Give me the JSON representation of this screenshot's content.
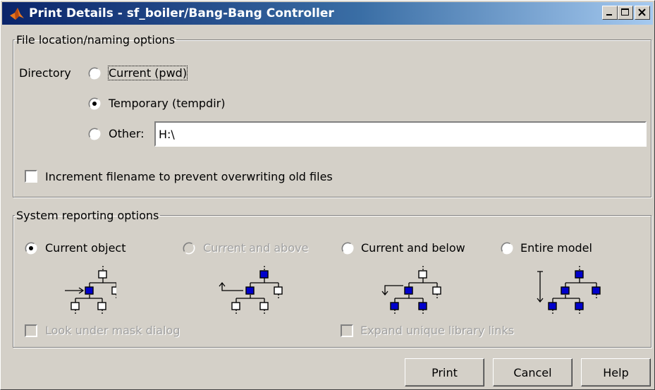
{
  "window": {
    "title": "Print Details - sf_boiler/Bang-Bang Controller",
    "controls": [
      "minimize-icon",
      "maximize-icon",
      "close-icon"
    ]
  },
  "file_options": {
    "legend": "File location/naming options",
    "directory_label": "Directory",
    "radios": {
      "current": "Current (pwd)",
      "temporary": "Temporary (tempdir)",
      "other": "Other:"
    },
    "selected": "temporary",
    "other_path": "H:\\",
    "increment_label": "Increment filename to prevent overwriting old files",
    "increment_checked": false
  },
  "system_options": {
    "legend": "System reporting options",
    "radios": {
      "current_object": "Current object",
      "current_and_above": "Current and above",
      "current_and_below": "Current and below",
      "entire_model": "Entire model"
    },
    "selected": "current_object",
    "disabled": [
      "current_and_above"
    ],
    "look_under_mask_label": "Look under mask dialog",
    "expand_library_links_label": "Expand unique library links"
  },
  "buttons": {
    "print": "Print",
    "cancel": "Cancel",
    "help": "Help"
  },
  "colors": {
    "dialog_bg": "#d4d0c8",
    "title_start": "#0a246a",
    "title_end": "#a6caf0",
    "tree_node_selected": "#0000cc"
  },
  "icons": {
    "app": "matlab-logo-icon",
    "tree_current_object": "hierarchy-current-object-icon",
    "tree_current_and_above": "hierarchy-current-and-above-icon",
    "tree_current_and_below": "hierarchy-current-and-below-icon",
    "tree_entire_model": "hierarchy-entire-model-icon"
  }
}
